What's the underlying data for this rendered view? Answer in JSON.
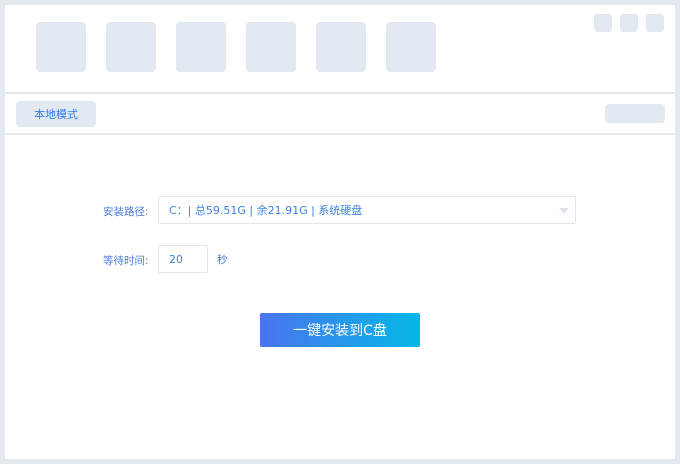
{
  "tab": {
    "label": "本地模式"
  },
  "form": {
    "path_label": "安装路径:",
    "path_value": "C：| 总59.51G | 余21.91G | 系统硬盘",
    "wait_label": "等待时间:",
    "wait_value": "20",
    "wait_unit": "秒"
  },
  "install_button": "一键安装到C盘"
}
